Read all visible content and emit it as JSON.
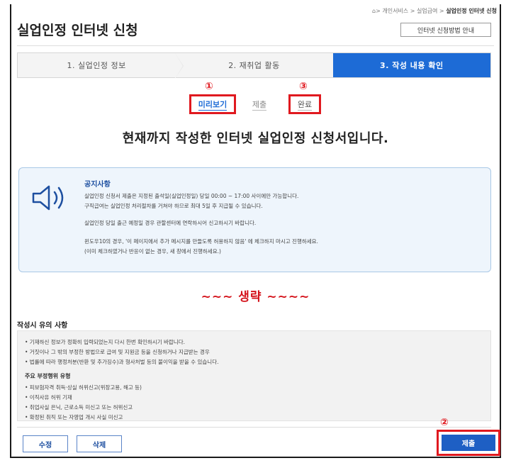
{
  "breadcrumb": {
    "home_icon": "home-icon",
    "trail": "> 개인서비스 > 실업급여 > ",
    "current": "실업인정 인터넷 신청"
  },
  "page_title": "실업인정 인터넷 신청",
  "guide_button": "인터넷 신청방법 안내",
  "steps": [
    {
      "label": "1. 실업인정 정보",
      "active": false
    },
    {
      "label": "2. 재취업 활동",
      "active": false
    },
    {
      "label": "3. 작성 내용 확인",
      "active": true
    }
  ],
  "annotations": {
    "n1": "①",
    "n2": "②",
    "n3": "③"
  },
  "subtabs": {
    "preview": "미리보기",
    "submit": "제출",
    "done": "완료"
  },
  "headline": "현재까지 작성한 인터넷 실업인정 신청서입니다.",
  "notice": {
    "icon": "speaker-icon",
    "title": "공지사항",
    "lines": [
      "실업인정 신청서 제출은 지정된 출석일(실업인정일) 당일 00:00 ~ 17:00 사이에만 가능합니다.",
      "구직급여는 실업인정 처리절차를 거쳐야 하므로 최대 5일 후 지급될 수 있습니다.",
      "실업인정 당일 출근 예정일 경우 관할센터에 연락하시어 신고하시기 바랍니다.",
      "윈도우10의 경우, '이 페이지에서 추가 메시지를 만들도록 허용하지 않음' 에 체크하지 마시고 진행하세요.",
      "(이미 체크하였거나 반응이 없는 경우, 새 창에서 진행하세요.)"
    ]
  },
  "omitted_label": "~~~ 생략 ~~~~",
  "cautions": {
    "title": "작성시 유의 사항",
    "items": [
      "• 기재하신 정보가 정확히 입력되었는지 다시 한번 확인하시기 바랍니다.",
      "• 거짓이나 그 밖의 부정한 방법으로 급여 및 지원금 등을 신청하거나 지급받는 경우",
      "• 법률에 따라 행정처분(반환 및 추가징수)과 형사처벌 등의 불이익을 받을 수 있습니다."
    ],
    "fraud_title": "주요 부정행위 유형",
    "fraud_items": [
      "• 피보험자격 취득·상실 허위신고(위장고용, 해고 등)",
      "• 이직사유 허위 기재",
      "• 취업사실 은닉, 근로소득 미신고 또는 허위신고",
      "• 확정된 취직 또는 자영업 개시 사실 미신고"
    ]
  },
  "buttons": {
    "edit": "수정",
    "delete": "삭제",
    "submit": "제출"
  },
  "colors": {
    "accent": "#1d6bd6",
    "highlight": "#e0191f",
    "notice_bg": "#eef5fc"
  }
}
